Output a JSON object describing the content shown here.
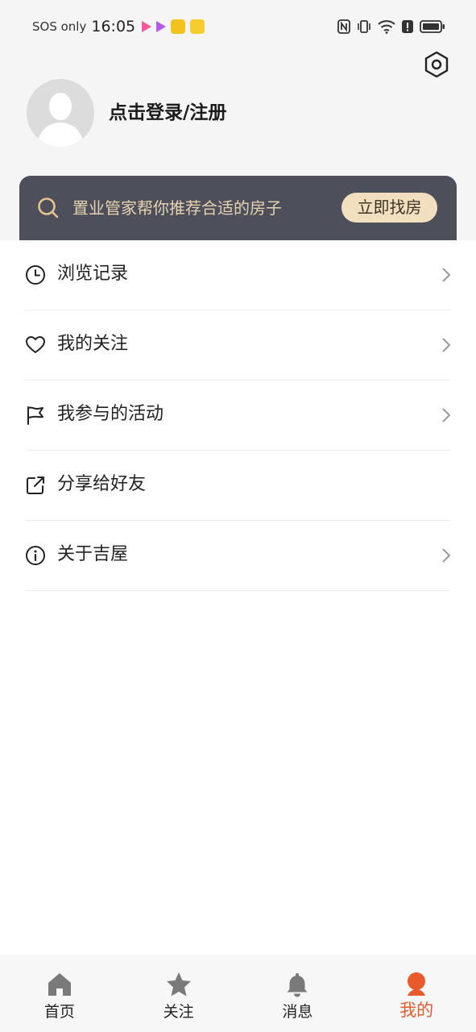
{
  "status_bar": {
    "carrier": "SOS only",
    "time": "16:05"
  },
  "profile": {
    "login_text": "点击登录/注册"
  },
  "banner": {
    "text": "置业管家帮你推荐合适的房子",
    "button": "立即找房"
  },
  "menu": {
    "items": [
      {
        "label": "浏览记录",
        "icon": "clock-icon",
        "chevron": true
      },
      {
        "label": "我的关注",
        "icon": "heart-icon",
        "chevron": true
      },
      {
        "label": "我参与的活动",
        "icon": "flag-icon",
        "chevron": true
      },
      {
        "label": "分享给好友",
        "icon": "share-icon",
        "chevron": false
      },
      {
        "label": "关于吉屋",
        "icon": "info-icon",
        "chevron": true
      }
    ]
  },
  "tabs": [
    {
      "label": "首页",
      "icon": "home-icon",
      "active": false
    },
    {
      "label": "关注",
      "icon": "star-icon",
      "active": false
    },
    {
      "label": "消息",
      "icon": "bell-icon",
      "active": false
    },
    {
      "label": "我的",
      "icon": "person-icon",
      "active": true
    }
  ],
  "colors": {
    "accent": "#e85a2c",
    "banner_bg": "#4d4f5b",
    "banner_text": "#e6d2ae",
    "banner_button_bg": "#f1dfbf"
  }
}
